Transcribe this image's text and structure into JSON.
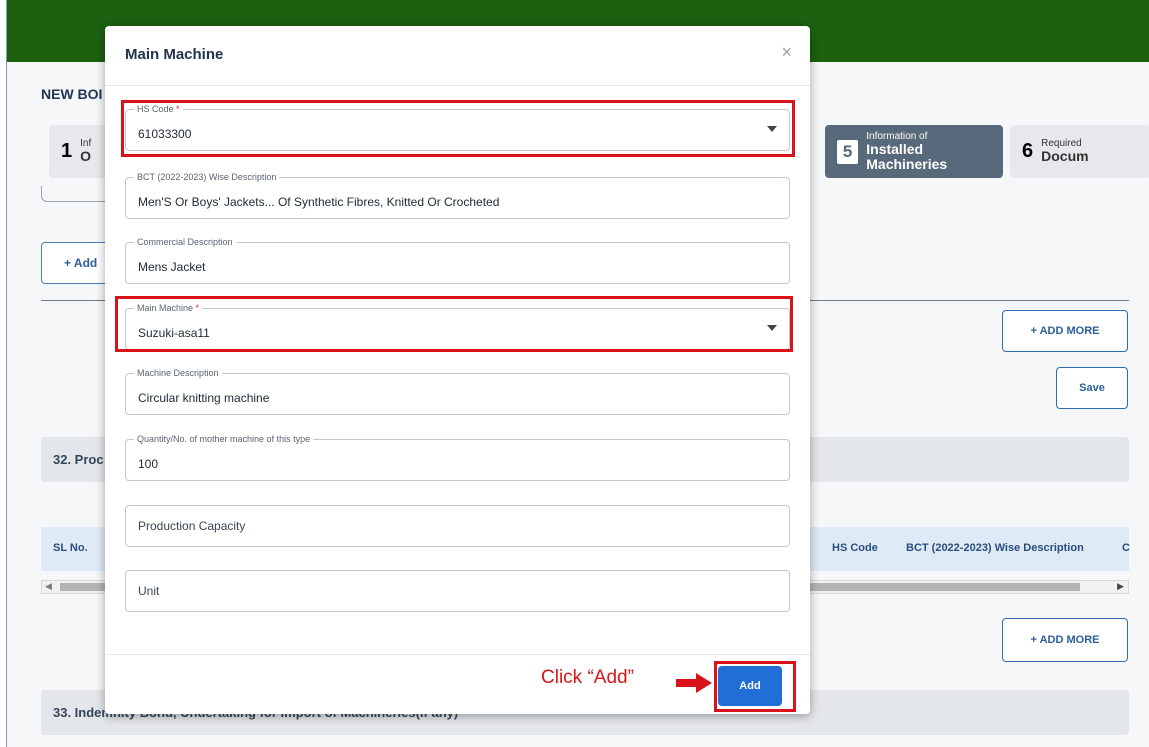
{
  "background": {
    "page_title": "NEW BOI",
    "steps": [
      {
        "num": "1",
        "small": "Inf",
        "big": "O"
      },
      {
        "num": "5",
        "small": "Information of",
        "big": "Installed Machineries"
      },
      {
        "num": "6",
        "small": "Required",
        "big": "Docum"
      }
    ],
    "add_button_label": "+ Add",
    "add_more_label": "+ ADD MORE",
    "save_label": "Save",
    "section_32": "32. Proc",
    "section_33": "33. Indemnity Bond, Undertaking for Import of Machineries(if any)",
    "table_headers": {
      "sl": "SL No.",
      "hs": "HS Code",
      "bct": "BCT (2022-2023) Wise Description",
      "c": "C"
    },
    "colors": {
      "topbar": "#1c6110",
      "active_step": "#57697a",
      "accent": "#1f6fd6"
    }
  },
  "modal": {
    "title": "Main Machine",
    "close_icon": "×",
    "fields": {
      "hs_code": {
        "label": "HS Code",
        "required": "*",
        "value": "61033300"
      },
      "bct_desc": {
        "label": "BCT (2022-2023) Wise Description",
        "value": "Men'S Or Boys' Jackets... Of Synthetic Fibres, Knitted Or Crocheted"
      },
      "commercial_desc": {
        "label": "Commercial Description",
        "value": "Mens Jacket"
      },
      "main_machine": {
        "label": "Main Machine",
        "required": "*",
        "value": "Suzuki-asa11"
      },
      "machine_desc": {
        "label": "Machine Description",
        "value": "Circular knitting machine"
      },
      "quantity": {
        "label": "Quantity/No. of mother machine of this type",
        "value": "100"
      },
      "production_capacity": {
        "placeholder": "Production Capacity"
      },
      "unit": {
        "placeholder": "Unit"
      }
    },
    "add_label": "Add"
  },
  "annotation": {
    "click_note": "Click “Add”",
    "highlight_color": "#d8141a"
  }
}
